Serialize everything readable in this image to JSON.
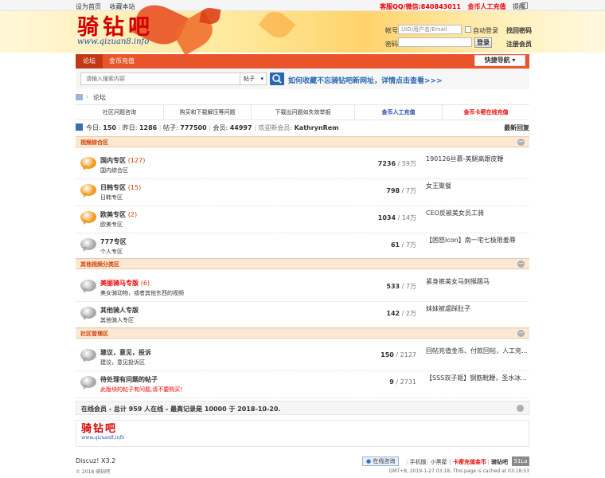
{
  "topbar": {
    "set_home": "设为首页",
    "bookmark": "收藏本站",
    "qq": "客服QQ/微信:840843011",
    "recharge": "金币人工充值",
    "reminder": "提醒"
  },
  "logo": {
    "cn": "骑钻吧",
    "url": "www.qizuan8.info"
  },
  "login": {
    "account_label": "帐号",
    "account_placeholder": "UID/用户名/Email",
    "auto_login": "自动登录",
    "find_pwd": "找回密码",
    "password_label": "密码",
    "login_btn": "登录",
    "register": "注册会员"
  },
  "nav": {
    "items": [
      "论坛",
      "金币充值"
    ],
    "quick": "快捷导航"
  },
  "search": {
    "placeholder": "请输入搜索内容",
    "type": "帖子",
    "tip": "如何收藏不忘骑钻吧新网址，详情点击查看>>>"
  },
  "crumb": {
    "current": "论坛"
  },
  "quicklinks": [
    "社区问题咨询",
    "购买和下载解压等问题",
    "下载出问题如失效举报",
    "金币人工充值",
    "金币卡密在线充值"
  ],
  "stats": {
    "today_label": "今日:",
    "today": "150",
    "yesterday_label": "昨日:",
    "yesterday": "1286",
    "posts_label": "帖子:",
    "posts": "777500",
    "members_label": "会员:",
    "members": "44997",
    "welcome": "欢迎新会员:",
    "newest": "KathrynRem",
    "latest": "最新回复"
  },
  "sections": [
    {
      "title": "视频综合区",
      "forums": [
        {
          "name": "国内专区",
          "count": "(127)",
          "desc": "国内综合区",
          "topics": "7236",
          "posts": "59万",
          "last_title": "190126丝慕-美腿高跟皮鞭",
          "last_time": "12 分钟前 948567481",
          "color": "#f29a1d"
        },
        {
          "name": "日韩专区",
          "count": "(15)",
          "desc": "日韩专区",
          "topics": "798",
          "posts": "7万",
          "last_title": "女王聚餐",
          "last_time": "半小时前 ztx123",
          "color": "#f29a1d"
        },
        {
          "name": "欧美专区",
          "count": "(2)",
          "desc": "欧美专区",
          "topics": "1034",
          "posts": "14万",
          "last_title": "CEO反被美女员工骑",
          "last_time": "12 分钟前 948567481",
          "color": "#f29a1d"
        },
        {
          "name": "777专区",
          "count": "",
          "desc": "个人专区",
          "topics": "61",
          "posts": "7万",
          "last_title": "【困怒Icon】南一宅七极限羞辱",
          "last_time": "昨天 13:09 m3064",
          "color": "#a9a9a9"
        }
      ]
    },
    {
      "title": "其他视频分类区",
      "forums": [
        {
          "name": "美丽骑马专版",
          "count": "(6)",
          "desc": "美女骑动物，或者其他东西的视频",
          "topics": "533",
          "posts": "7万",
          "last_title": "紧身裤美女马刺猴踢马",
          "last_time": "昨天 19:14 wazq897571",
          "color": "#a9a9a9"
        },
        {
          "name": "其他骑人专版",
          "count": "",
          "desc": "其他骑人专区",
          "topics": "142",
          "posts": "2万",
          "last_title": "妹妹被虐踩肚子",
          "last_time": "昨天 15:40 yufei_13",
          "color": "#a9a9a9"
        }
      ]
    },
    {
      "title": "社区管理区",
      "forums": [
        {
          "name": "建议，意见，投诉",
          "count": "",
          "desc": "建议，意见投诉区",
          "topics": "150",
          "posts": "2127",
          "last_title": "回帖充值金币、付款回帖，人工充...",
          "last_time": "昨天 21:18 7758520",
          "color": "#a9a9a9"
        },
        {
          "name": "待处理有问题的帖子",
          "count": "",
          "desc": "此版块的帖子有问题,请不要购买！",
          "topics": "9",
          "posts": "2731",
          "last_title": "【SSS双子姬】钢筋靴鞭，圣水冰...",
          "last_time": "3 天前 qq405253437",
          "color": "#a9a9a9"
        }
      ]
    }
  ],
  "online": {
    "text": "在线会员 - 总计 959 人在线 - 最高记录是 10000 于 2018-10-20."
  },
  "flink": {
    "cn": "骑钻吧",
    "url": "www.qizuan8.info"
  },
  "footer": {
    "version": "Discuz! X3.2",
    "copyright": "© 2018 骑钻吧",
    "service": "在线咨询",
    "mobile": "手机版",
    "blackroom": "小黑屋",
    "card": "卡密充值金币",
    "brand": "骑钻吧",
    "badge": "51La",
    "gmt": "GMT+8, 2019-1-27 03:18, This page is cached at 03:18:53"
  }
}
